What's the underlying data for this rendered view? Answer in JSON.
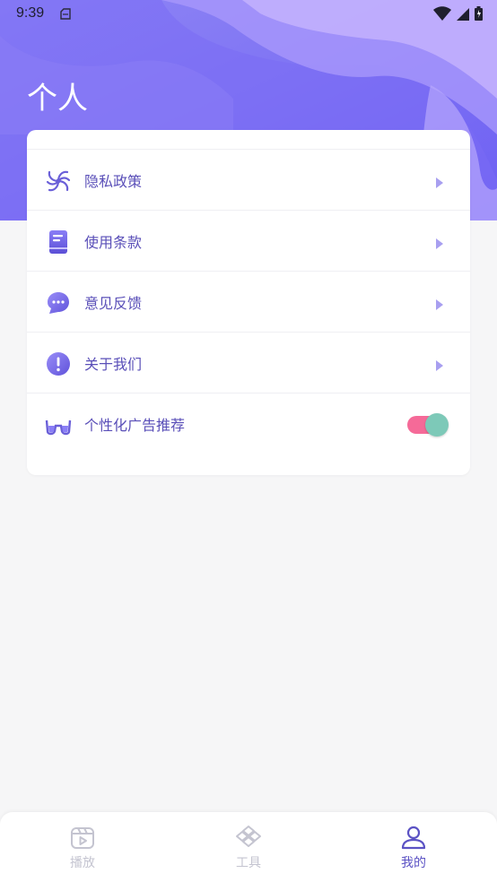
{
  "status_bar": {
    "time": "9:39"
  },
  "header": {
    "title": "个人"
  },
  "menu": {
    "items": [
      {
        "label": "隐私政策",
        "icon": "pinwheel-icon"
      },
      {
        "label": "使用条款",
        "icon": "document-icon"
      },
      {
        "label": "意见反馈",
        "icon": "chat-bubble-icon"
      },
      {
        "label": "关于我们",
        "icon": "info-exclamation-icon"
      }
    ],
    "toggle_item": {
      "label": "个性化广告推荐",
      "icon": "glasses-icon",
      "enabled": true
    }
  },
  "bottom_nav": {
    "items": [
      {
        "label": "播放",
        "icon": "play-icon",
        "active": false
      },
      {
        "label": "工具",
        "icon": "tools-icon",
        "active": false
      },
      {
        "label": "我的",
        "icon": "user-icon",
        "active": true
      }
    ]
  },
  "colors": {
    "accent": "#5b52c4",
    "header_gradient_start": "#8f86f5",
    "header_gradient_end": "#6c5cf2",
    "toggle_track": "#f56a98",
    "toggle_knob": "#7dc9b8",
    "inactive_nav": "#c4c4d0"
  }
}
